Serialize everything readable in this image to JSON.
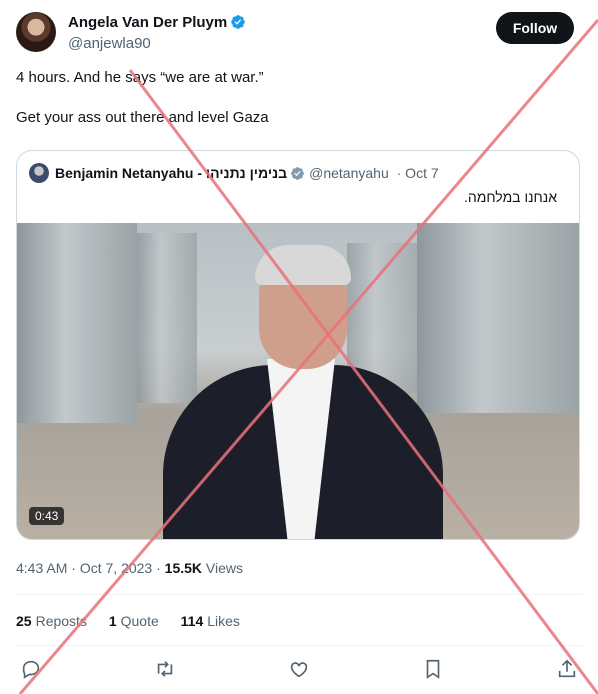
{
  "author": {
    "name": "Angela Van Der Pluym",
    "handle": "@anjewla90",
    "follow_label": "Follow"
  },
  "tweet": {
    "text": "4 hours. And he says “we are at war.”\n\nGet your ass out there and level Gaza"
  },
  "quoted": {
    "name": "Benjamin Netanyahu - בנימין נתניהו",
    "handle": "@netanyahu",
    "date": "· Oct 7",
    "text": "אנחנו במלחמה.",
    "video_duration": "0:43"
  },
  "meta": {
    "time": "4:43 AM",
    "date": "Oct 7, 2023",
    "separator": "·",
    "views_count": "15.5K",
    "views_label": "Views"
  },
  "stats": {
    "reposts_count": "25",
    "reposts_label": "Reposts",
    "quotes_count": "1",
    "quotes_label": "Quote",
    "likes_count": "114",
    "likes_label": "Likes"
  },
  "colors": {
    "verified": "#1d9bf0",
    "overlay_x": "#e8727a",
    "follow_bg": "#0f1419"
  },
  "icons": [
    "verified-badge-icon",
    "reply-icon",
    "repost-icon",
    "like-icon",
    "bookmark-icon",
    "share-icon"
  ]
}
